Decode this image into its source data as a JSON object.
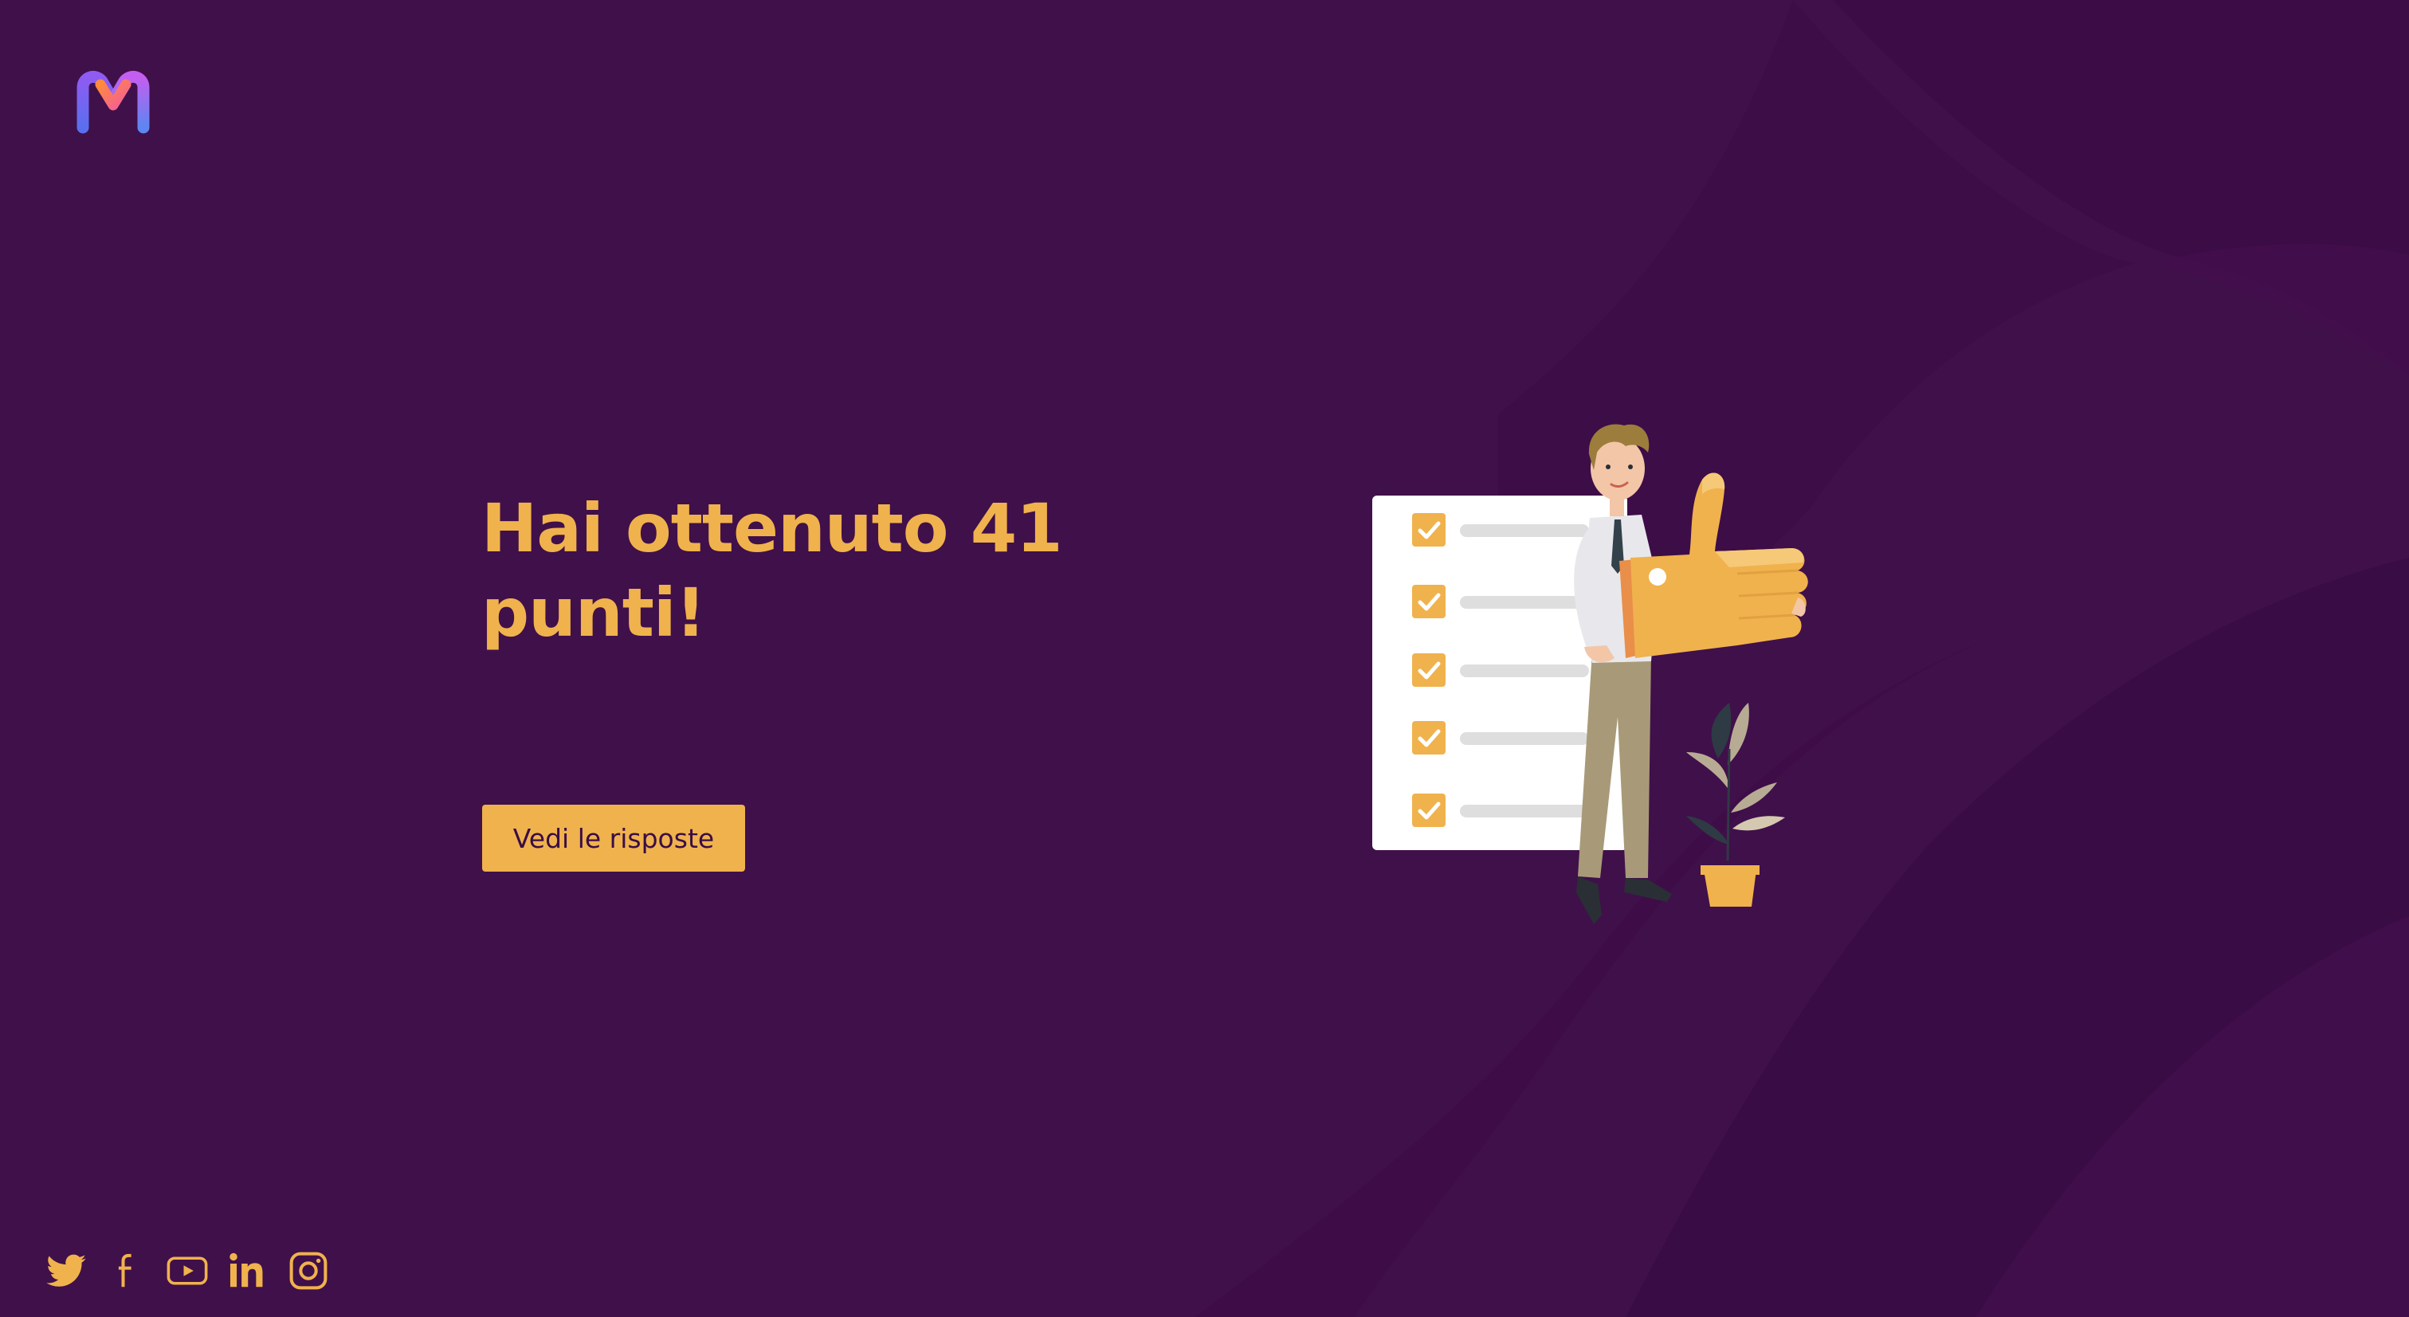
{
  "brand": {
    "logo_icon": "m-logo-icon",
    "colors": {
      "background": "#40104a",
      "accent": "#f0b24d",
      "button_text": "#3a0d45"
    }
  },
  "result": {
    "headline": "Hai ottenuto 41 punti!"
  },
  "actions": {
    "view_answers_label": "Vedi le risposte"
  },
  "illustration": {
    "icon": "man-thumbs-up-checklist-illustration",
    "checklist_checked_items": 5
  },
  "social": [
    {
      "name": "twitter",
      "icon": "twitter-icon"
    },
    {
      "name": "facebook",
      "icon": "facebook-icon"
    },
    {
      "name": "youtube",
      "icon": "youtube-icon"
    },
    {
      "name": "linkedin",
      "icon": "linkedin-icon"
    },
    {
      "name": "instagram",
      "icon": "instagram-icon"
    }
  ]
}
